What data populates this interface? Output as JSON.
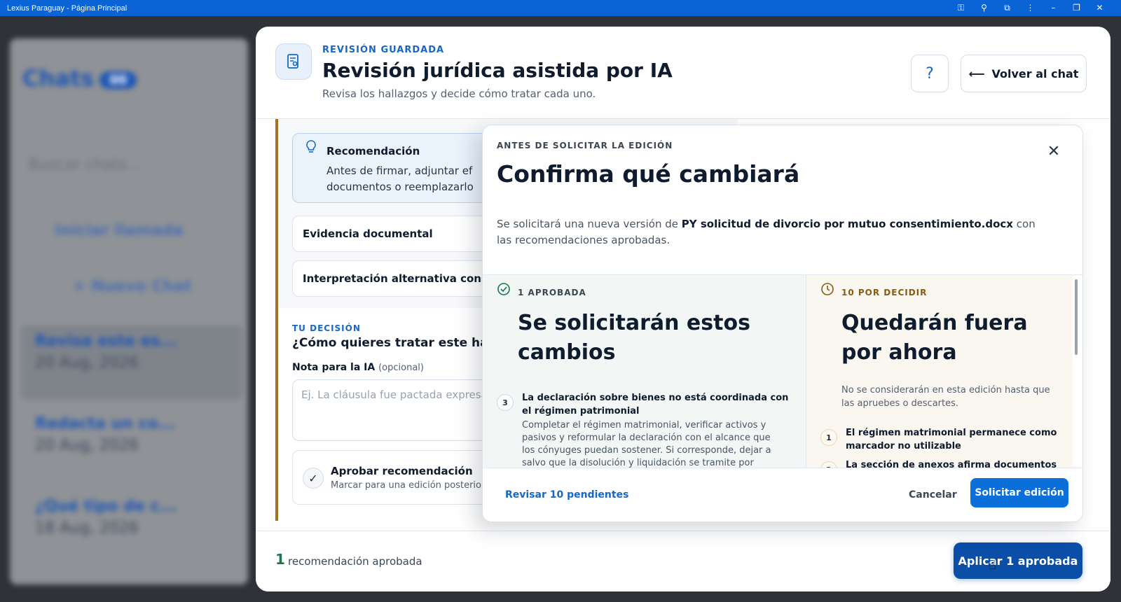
{
  "window": {
    "title": "Lexius Paraguay - Página Principal"
  },
  "background": {
    "sidebar_title": "Chats",
    "sidebar_badge": "00",
    "search_placeholder": "Buscar chats...",
    "start_call": "Iniciar llamada",
    "new_chat": "+ Nuevo Chat",
    "chats": [
      {
        "title": "Revisa este es...",
        "date": "20 Aug, 2026"
      },
      {
        "title": "Redacta un co...",
        "date": "20 Aug, 2026"
      },
      {
        "title": "¿Qué tipo de c...",
        "date": "18 Aug, 2026"
      }
    ]
  },
  "header": {
    "kicker": "REVISIÓN GUARDADA",
    "title": "Revisión jurídica asistida por IA",
    "subtitle": "Revisa los hallazgos y decide cómo tratar cada uno.",
    "help_label": "?",
    "back_label": "Volver al chat"
  },
  "finding": {
    "recommendation_title": "Recomendación",
    "recommendation_text_1": "Antes de firmar, adjuntar ef",
    "recommendation_text_2": "documentos o reemplazarlo",
    "evidence_label": "Evidencia documental",
    "alternative_label": "Interpretación alternativa consid"
  },
  "decision": {
    "kicker": "TU DECISIÓN",
    "question": "¿Cómo quieres tratar este halla",
    "note_label": "Nota para la IA",
    "note_optional": "(opcional)",
    "note_placeholder": "Ej. La cláusula fue pactada expresa",
    "approve_title": "Aprobar recomendación",
    "approve_sub": "Marcar para una edición posterior"
  },
  "footer": {
    "count": "1",
    "count_label": "recomendación aprobada",
    "apply_label": "Aplicar 1 aprobada"
  },
  "dialog": {
    "kicker": "ANTES DE SOLICITAR LA EDICIÓN",
    "title": "Confirma qué cambiará",
    "desc_pre": "Se solicitará una nueva versión de",
    "desc_file": "PY solicitud de divorcio por mutuo consentimiento.docx",
    "desc_post": "con las recomendaciones aprobadas.",
    "approved": {
      "kicker": "1 APROBADA",
      "heading": "Se solicitarán estos cambios",
      "items": [
        {
          "num": "3",
          "title": "La declaración sobre bienes no está coordinada con el régimen patrimonial",
          "body": "Completar el régimen matrimonial, verificar activos y pasivos y reformular la declaración con el alcance que los cónyuges puedan sostener. Si corresponde, dejar a salvo que la disolución y liquidación se tramite por cuerda separada conforme al procedimiento pertinente."
        }
      ]
    },
    "pending": {
      "kicker": "10 POR DECIDIR",
      "heading": "Quedarán fuera por ahora",
      "note": "No se considerarán en esta edición hasta que las apruebes o descartes.",
      "items": [
        {
          "num": "1",
          "title": "El régimen matrimonial permanece como marcador no utilizable"
        },
        {
          "num": "2",
          "title": "La sección de anexos afirma documentos"
        }
      ]
    },
    "review_pending_label": "Revisar 10 pendientes",
    "cancel_label": "Cancelar",
    "submit_label": "Solicitar edición"
  },
  "colors": {
    "accent": "#1767c4",
    "primary_button": "#0b4ea8",
    "dialog_button": "#0b6fd9",
    "approved_green": "#157a4a",
    "pending_amber": "#8a5a10",
    "titlebar": "#0a64d6"
  }
}
